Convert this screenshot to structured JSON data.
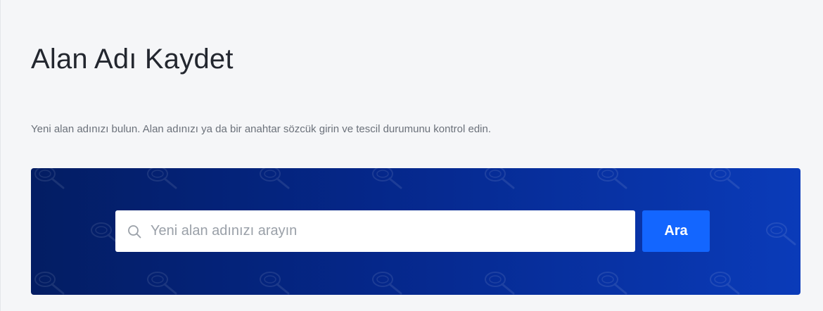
{
  "page": {
    "title": "Alan Adı Kaydet",
    "description": "Yeni alan adınızı bulun. Alan adınızı ya da bir anahtar sözcük girin ve tescil durumunu kontrol edin."
  },
  "search": {
    "placeholder": "Yeni alan adınızı arayın",
    "value": "",
    "button_label": "Ara",
    "icon": "search-icon"
  },
  "colors": {
    "background": "#f5f6f8",
    "banner_start": "#031d63",
    "banner_end": "#0a3bb9",
    "button": "#1366ff",
    "title": "#23272f",
    "description": "#6b717a"
  }
}
